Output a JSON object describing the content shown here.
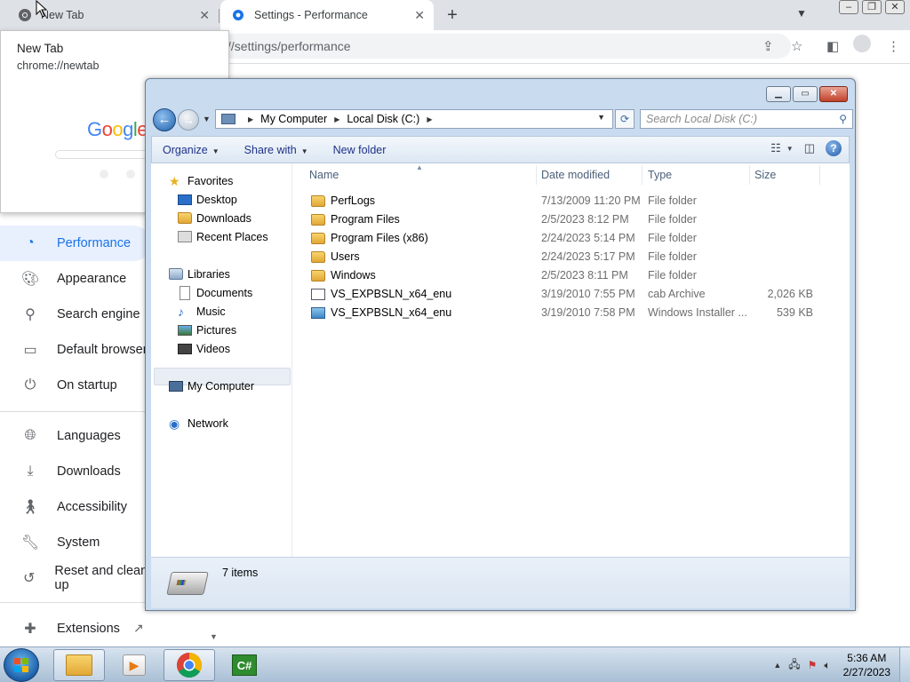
{
  "chrome": {
    "tabs": [
      {
        "title": "New Tab",
        "icon": "chrome-icon"
      },
      {
        "title": "Settings - Performance",
        "icon": "gear-icon"
      }
    ],
    "omnibox_text": "//settings/performance",
    "tab_preview": {
      "title": "New Tab",
      "url": "chrome://newtab",
      "thumbnail_logo": "Google"
    },
    "settings_nav": [
      {
        "label": "Performance",
        "icon": "speedometer-icon",
        "active": true
      },
      {
        "label": "Appearance",
        "icon": "palette-icon"
      },
      {
        "label": "Search engine",
        "icon": "search-icon"
      },
      {
        "label": "Default browser",
        "icon": "browser-window-icon"
      },
      {
        "label": "On startup",
        "icon": "power-icon"
      },
      {
        "label": "Languages",
        "icon": "globe-icon"
      },
      {
        "label": "Downloads",
        "icon": "download-icon"
      },
      {
        "label": "Accessibility",
        "icon": "accessibility-icon"
      },
      {
        "label": "System",
        "icon": "wrench-icon"
      },
      {
        "label": "Reset and clean up",
        "icon": "history-icon"
      },
      {
        "label": "Extensions",
        "icon": "puzzle-icon"
      }
    ],
    "accent": "#1a73e8"
  },
  "explorer": {
    "breadcrumb": [
      "My Computer",
      "Local Disk (C:)"
    ],
    "search_placeholder": "Search Local Disk (C:)",
    "commands": {
      "organize": "Organize",
      "share_with": "Share with",
      "new_folder": "New folder"
    },
    "nav_pane": {
      "favorites": "Favorites",
      "favorites_items": [
        "Desktop",
        "Downloads",
        "Recent Places"
      ],
      "libraries": "Libraries",
      "libraries_items": [
        "Documents",
        "Music",
        "Pictures",
        "Videos"
      ],
      "computer": "My Computer",
      "network": "Network"
    },
    "columns": {
      "name": "Name",
      "date": "Date modified",
      "type": "Type",
      "size": "Size"
    },
    "files": [
      {
        "name": "PerfLogs",
        "date": "7/13/2009 11:20 PM",
        "type": "File folder",
        "size": "",
        "icon": "folder-icon"
      },
      {
        "name": "Program Files",
        "date": "2/5/2023 8:12 PM",
        "type": "File folder",
        "size": "",
        "icon": "folder-icon"
      },
      {
        "name": "Program Files (x86)",
        "date": "2/24/2023 5:14 PM",
        "type": "File folder",
        "size": "",
        "icon": "folder-icon"
      },
      {
        "name": "Users",
        "date": "2/24/2023 5:17 PM",
        "type": "File folder",
        "size": "",
        "icon": "folder-icon"
      },
      {
        "name": "Windows",
        "date": "2/5/2023 8:11 PM",
        "type": "File folder",
        "size": "",
        "icon": "folder-icon"
      },
      {
        "name": "VS_EXPBSLN_x64_enu",
        "date": "3/19/2010 7:55 PM",
        "type": "cab Archive",
        "size": "2,026 KB",
        "icon": "cab-file-icon"
      },
      {
        "name": "VS_EXPBSLN_x64_enu",
        "date": "3/19/2010 7:58 PM",
        "type": "Windows Installer ...",
        "size": "539 KB",
        "icon": "installer-file-icon"
      }
    ],
    "status": "7 items"
  },
  "taskbar": {
    "apps": [
      "windows-explorer-icon",
      "media-player-icon",
      "chrome-icon",
      "csharp-icon"
    ],
    "time": "5:36 AM",
    "date": "2/27/2023"
  }
}
